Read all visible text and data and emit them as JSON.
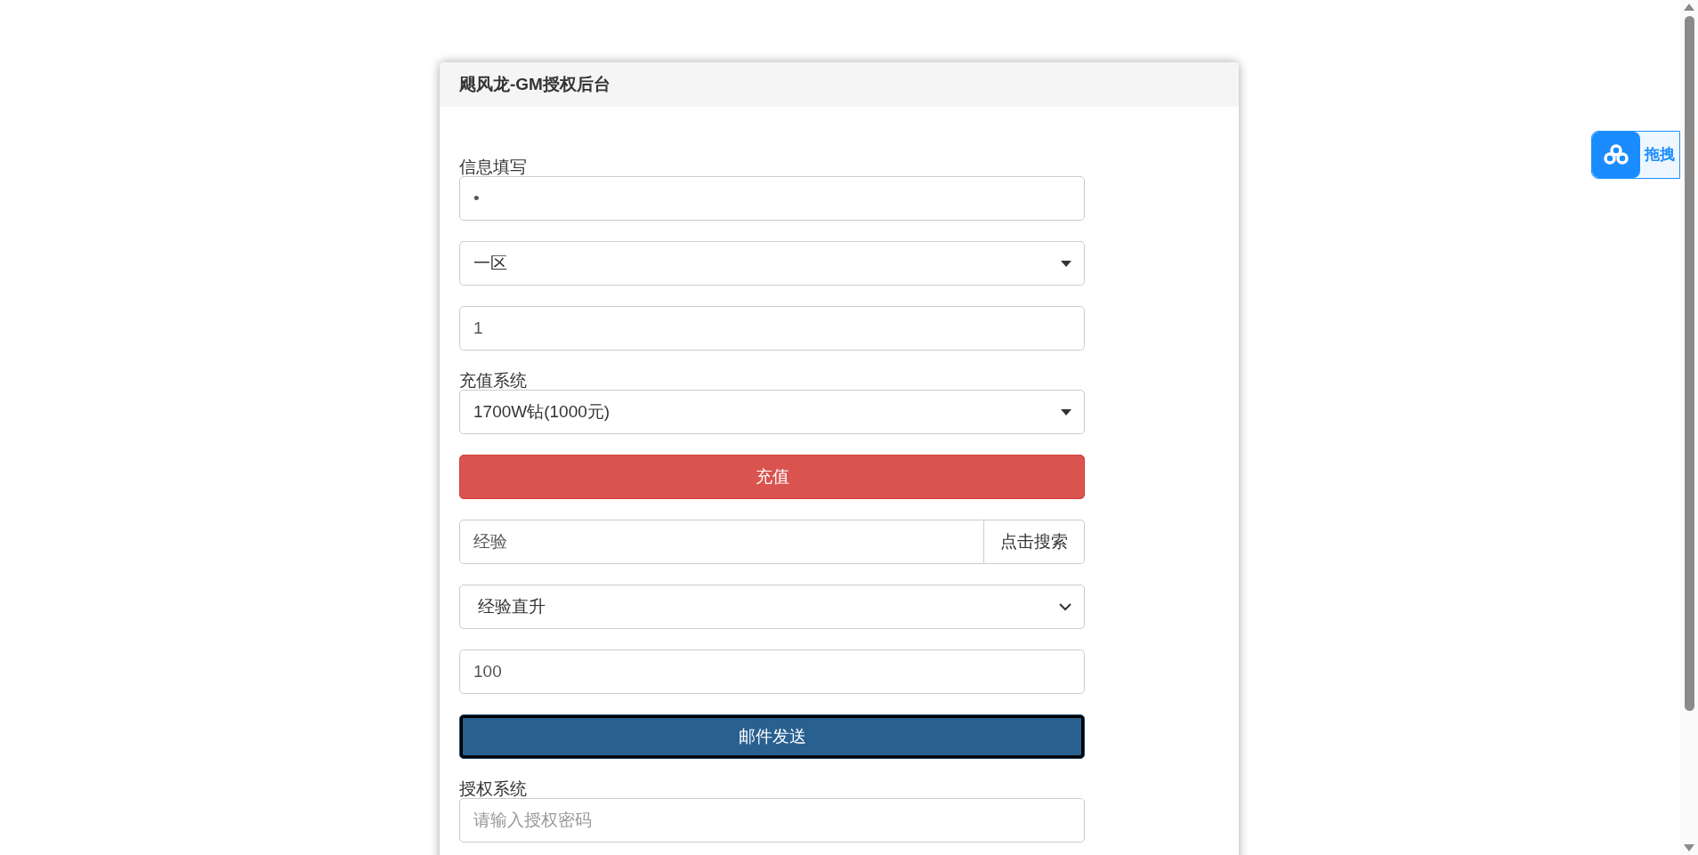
{
  "panel": {
    "title": "飓风龙-GM授权后台"
  },
  "sections": [
    {
      "label": "信息填写",
      "fields": [
        {
          "kind": "input",
          "value": "•"
        },
        {
          "kind": "select",
          "value": "一区"
        },
        {
          "kind": "input",
          "value": "1"
        }
      ]
    },
    {
      "label": "充值系统",
      "fields": [
        {
          "kind": "select",
          "value": "1700W钻(1000元)"
        },
        {
          "kind": "danger-button",
          "label": "充值",
          "focused": false
        },
        {
          "kind": "search",
          "value": "经验",
          "button": "点击搜索"
        },
        {
          "kind": "native-select",
          "value": "经验直升"
        },
        {
          "kind": "input",
          "value": "100"
        },
        {
          "kind": "primary-button",
          "label": "邮件发送",
          "focused": true
        }
      ]
    },
    {
      "label": "授权系统",
      "fields": [
        {
          "kind": "input",
          "placeholder": "请输入授权密码"
        }
      ]
    }
  ],
  "floating_widget": {
    "label": "拖拽"
  }
}
